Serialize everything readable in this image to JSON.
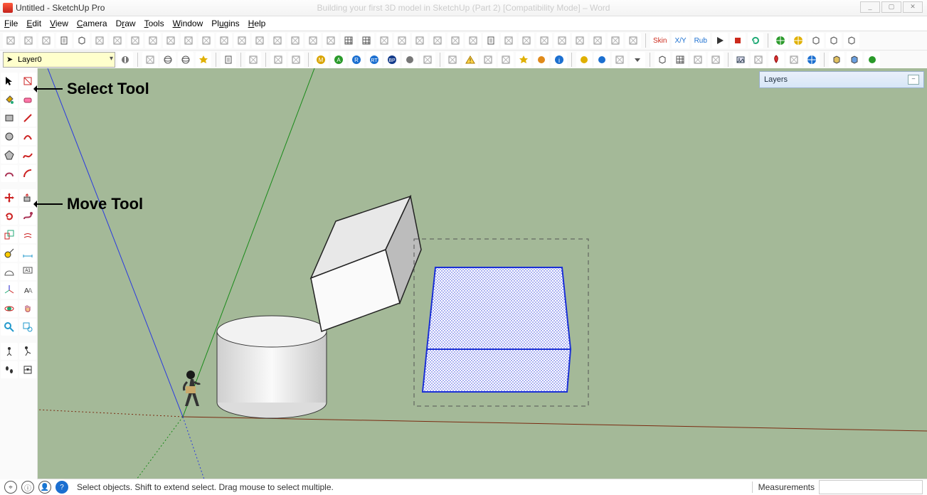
{
  "window": {
    "title": "Untitled - SketchUp Pro",
    "faint_center_text": "Building your first 3D model in SketchUp (Part 2) [Compatibility Mode] – Word",
    "controls": {
      "min": "_",
      "max": "▢",
      "close": "✕"
    }
  },
  "menu": {
    "items": [
      "File",
      "Edit",
      "View",
      "Camera",
      "Draw",
      "Tools",
      "Window",
      "Plugins",
      "Help"
    ]
  },
  "toolbars": {
    "row1_icons": [
      "select-dashed-icon",
      "undo-icon",
      "redo-icon",
      "print-icon",
      "cube-icon",
      "rotate-view-icon",
      "pan-icon",
      "rotate-axis-icon",
      "extrude-icon",
      "arc-icon",
      "curve-arrow-icon",
      "fold-icon",
      "line-3d-icon",
      "tape-icon",
      "eraser-red-icon",
      "stamp-icon",
      "roller-icon",
      "rect-icon",
      "rect-outline-icon",
      "grid-icon",
      "grid-3d-icon",
      "plane-icon",
      "push-icon",
      "line2-icon",
      "offset-icon",
      "select2-icon",
      "curve2-icon",
      "note-icon",
      "arrow-nw-icon",
      "eraser2-icon",
      "pushpin-icon",
      "curve3-icon",
      "section-icon",
      "section-fill-icon",
      "section-outline-icon",
      "section-show-icon",
      "sep",
      "skin-label",
      "xy-label",
      "rub-label",
      "play-icon",
      "stop-icon",
      "refresh-icon",
      "sep",
      "globe-green-icon",
      "globe-yellow-icon",
      "box-front-icon",
      "box-shaded-icon",
      "box-wire-icon"
    ],
    "row2": {
      "layer_current": "Layer0",
      "groups": [
        [
          "cursor-icon"
        ],
        [
          "iso-icon",
          "orbit-icon",
          "star-icon",
          "sep-narrow"
        ],
        [
          "sheet-icon",
          "sep-narrow"
        ],
        [
          "marker-icon",
          "sep-narrow"
        ],
        [
          "align-left-icon",
          "align-top-icon",
          "sep-narrow"
        ],
        [
          "m-icon",
          "a-icon",
          "r-icon",
          "rt-icon",
          "bp-icon",
          "g-ball-icon",
          "slice-icon",
          "sep-narrow"
        ],
        [
          "push-yellow-icon",
          "warn-icon",
          "pan2-icon",
          "square-purple-icon",
          "star2-icon",
          "ball-orange-icon",
          "info-icon",
          "sep-narrow"
        ],
        [
          "ball-yellow-icon",
          "ball-blue-icon",
          "pointer-icon",
          "dropdown-icon",
          "sep-narrow"
        ],
        [
          "cube3-icon",
          "hatch-icon",
          "clip-icon",
          "tool-icon",
          "sep-narrow"
        ],
        [
          "image-icon",
          "diamond-icon",
          "rocket-icon",
          "tools-icon",
          "globe2-icon",
          "sep-narrow"
        ],
        [
          "box-yellow-icon",
          "box-blue-icon",
          "ball-green-icon"
        ]
      ]
    },
    "special_labels": {
      "skin": "Skin",
      "xy": "X/Y",
      "rub": "Rub"
    }
  },
  "panels": {
    "layers_title": "Layers"
  },
  "annotations": {
    "select_tool": "Select Tool",
    "move_tool": "Move Tool"
  },
  "statusbar": {
    "hint": "Select objects. Shift to extend select. Drag mouse to select multiple.",
    "measurements_label": "Measurements",
    "measurements_value": ""
  },
  "left_toolbar": {
    "rows": [
      [
        "select-tool",
        "make-component-tool"
      ],
      [
        "paint-bucket-tool",
        "eraser-tool"
      ],
      [
        "rectangle-tool",
        "line-tool"
      ],
      [
        "circle-tool",
        "arc-tool"
      ],
      [
        "polygon-tool",
        "freehand-tool"
      ],
      [
        "curve-tool",
        "arc2-tool"
      ],
      [
        "gap"
      ],
      [
        "move-tool",
        "pushpull-tool"
      ],
      [
        "rotate-tool",
        "followme-tool"
      ],
      [
        "scale-tool",
        "offset-tool"
      ],
      [
        "tape-measure-tool",
        "dimension-tool"
      ],
      [
        "protractor-tool",
        "text-tool"
      ],
      [
        "axes-tool",
        "3dtext-tool"
      ],
      [
        "orbit-tool",
        "pan-tool"
      ],
      [
        "zoom-tool",
        "zoom-window-tool"
      ],
      [
        "gap"
      ],
      [
        "person-tool",
        "walk-tool"
      ],
      [
        "footprints-tool",
        "section-plane-tool"
      ]
    ]
  }
}
